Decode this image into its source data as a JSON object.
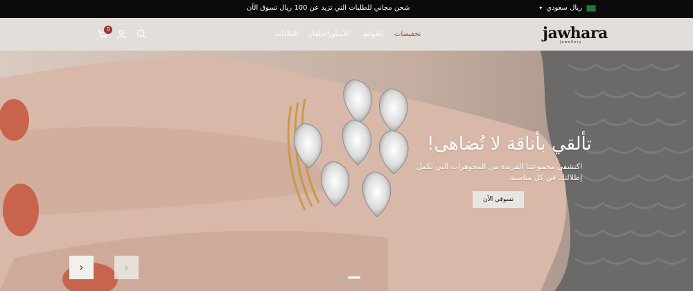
{
  "topbar": {
    "promo": "شحن مجاني للطلبات التي تزيد عن 100 ريال  تسوق الآن",
    "currency": "ريال سعودي"
  },
  "header": {
    "logo": "jawhara",
    "logo_sub": "jewellery",
    "nav": [
      "تخفيضات",
      "الخواتم",
      "الأساور",
      "الحلقان",
      "القلادات"
    ],
    "cart_count": "0"
  },
  "hero": {
    "heading": "تألقي بأناقة لا تُضاهى!",
    "subtitle": "اكتشفي مجموعتنا الفريدة من المجوهرات التي تكمل إطلالتك في كل مناسبة.",
    "button": "تسوقي الآن",
    "slides_active": 1,
    "slides_total": 2
  },
  "colors": {
    "topbar": "#0b0b0b",
    "header": "#e2deda",
    "sale": "#a14e3a",
    "badge": "#9b2f2a"
  },
  "icons": [
    "chevron-down-icon",
    "saudi-flag-icon",
    "search-icon",
    "user-icon",
    "cart-icon",
    "chevron-left-icon",
    "chevron-right-icon"
  ]
}
